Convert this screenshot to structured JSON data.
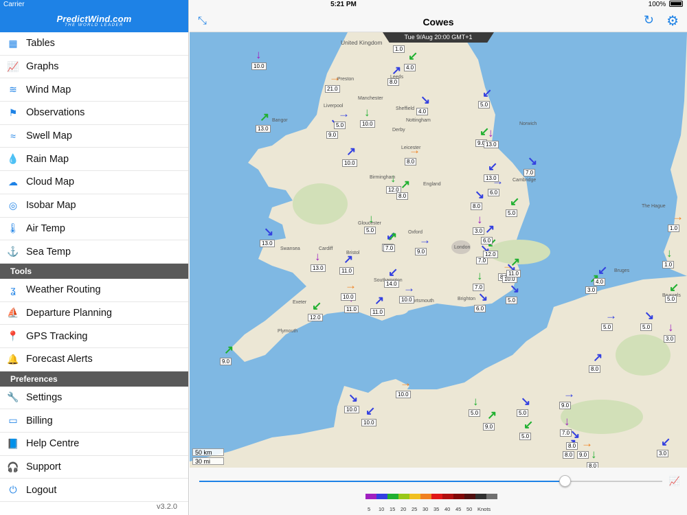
{
  "status": {
    "carrier": "Carrier",
    "time": "5:21 PM",
    "battery": "100%"
  },
  "logo": {
    "brand": "PredictWind.com",
    "tagline": "THE WORLD LEADER"
  },
  "menu": [
    {
      "label": "Tables",
      "icon": "table-icon"
    },
    {
      "label": "Graphs",
      "icon": "graph-icon"
    },
    {
      "label": "Wind Map",
      "icon": "wind-icon"
    },
    {
      "label": "Observations",
      "icon": "observations-icon"
    },
    {
      "label": "Swell Map",
      "icon": "swell-icon"
    },
    {
      "label": "Rain Map",
      "icon": "rain-icon"
    },
    {
      "label": "Cloud Map",
      "icon": "cloud-icon"
    },
    {
      "label": "Isobar Map",
      "icon": "isobar-icon"
    },
    {
      "label": "Air Temp",
      "icon": "thermometer-icon"
    },
    {
      "label": "Sea Temp",
      "icon": "sea-temp-icon"
    }
  ],
  "tools_header": "Tools",
  "tools": [
    {
      "label": "Weather Routing",
      "icon": "routing-icon"
    },
    {
      "label": "Departure Planning",
      "icon": "sailboat-icon"
    },
    {
      "label": "GPS Tracking",
      "icon": "pin-icon"
    },
    {
      "label": "Forecast Alerts",
      "icon": "alert-icon"
    }
  ],
  "prefs_header": "Preferences",
  "prefs": [
    {
      "label": "Settings",
      "icon": "wrench-icon"
    },
    {
      "label": "Billing",
      "icon": "billing-icon"
    },
    {
      "label": "Help Centre",
      "icon": "help-icon"
    },
    {
      "label": "Support",
      "icon": "headset-icon"
    },
    {
      "label": "Logout",
      "icon": "power-icon"
    }
  ],
  "version": "v3.2.0",
  "header": {
    "title": "Cowes"
  },
  "map": {
    "timestamp": "Tue 9/Aug 20:00 GMT+1",
    "scale_km": "50 km",
    "scale_mi": "30 mi",
    "wind_labels": [
      "1.0",
      "4.0",
      "10.0",
      "8.0",
      "21.0",
      "4.0",
      "5.0",
      "10.0",
      "13.0",
      "5.0",
      "9.0",
      "9.0",
      "13.0",
      "10.0",
      "8.0",
      "7.0",
      "13.0",
      "12.0",
      "8.0",
      "6.0",
      "8.0",
      "5.0",
      "3.0",
      "6.0",
      "1.0",
      "13.0",
      "7.0",
      "5.0",
      "7.0",
      "9.0",
      "7.0",
      "12.0",
      "13.0",
      "11.0",
      "8.0",
      "10.0",
      "14.0",
      "7.0",
      "11.0",
      "10.0",
      "5.0",
      "12.0",
      "11.0",
      "11.0",
      "10.0",
      "6.0",
      "4.0",
      "1.0",
      "3.0",
      "5.0",
      "5.0",
      "5.0",
      "3.0",
      "8.0",
      "10.0",
      "10.0",
      "10.0",
      "5.0",
      "9.0",
      "9.0",
      "5.0",
      "5.0",
      "7.0",
      "8.0",
      "9.0",
      "8.0",
      "3.0",
      "8.0",
      "9.0"
    ],
    "place_labels": [
      "United Kingdom",
      "Manchester",
      "Liverpool",
      "Leeds",
      "Preston",
      "Sheffield",
      "Nottingham",
      "Birmingham",
      "England",
      "London",
      "Bristol",
      "Cardiff",
      "Swansea",
      "Plymouth",
      "Exeter",
      "Southampton",
      "Portsmouth",
      "Brighton",
      "The Hague",
      "Brussels",
      "Bruges",
      "Oxford",
      "Cambridge",
      "Norwich",
      "Bangor",
      "Derby",
      "Leicester",
      "Gloucester"
    ]
  },
  "legend": {
    "colors": [
      "#a020c0",
      "#3340e0",
      "#20b030",
      "#98c818",
      "#f0c020",
      "#f08020",
      "#e01818",
      "#b01010",
      "#800808",
      "#501010",
      "#303030",
      "#707070"
    ],
    "labels": [
      "5",
      "10",
      "15",
      "20",
      "25",
      "30",
      "35",
      "40",
      "45",
      "50",
      "Knots"
    ]
  },
  "slider": {
    "value": 0.79
  }
}
